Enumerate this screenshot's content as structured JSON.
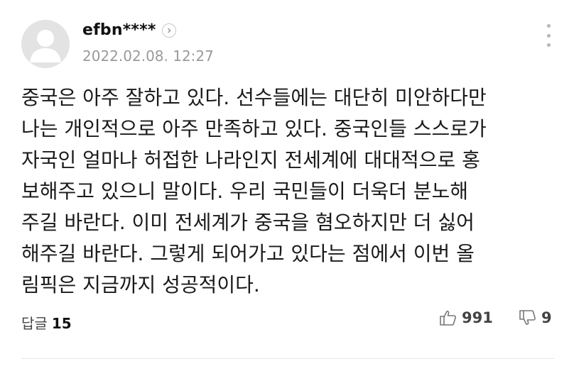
{
  "comment": {
    "username": "efbn****",
    "timestamp": "2022.02.08. 12:27",
    "lines": [
      "중국은 아주 잘하고 있다. 선수들에는 대단히 미안하다만",
      "나는 개인적으로 아주 만족하고 있다. 중국인들 스스로가",
      "자국인 얼마나 허접한 나라인지 전세계에 대대적으로 홍",
      "보해주고 있으니 말이다. 우리 국민들이 더욱더 분노해",
      "주길 바란다. 이미 전세계가 중국을 혐오하지만 더 싫어",
      "해주길 바란다. 그렇게 되어가고 있다는 점에서 이번 올",
      "림픽은 지금까지 성공적이다."
    ],
    "reply_label": "답글",
    "reply_count": "15",
    "likes": "991",
    "dislikes": "9"
  },
  "colors": {
    "text": "#1a1a1a",
    "muted": "#9a9a9a",
    "icon": "#b5b5b5",
    "divider": "#e6e6e6"
  }
}
